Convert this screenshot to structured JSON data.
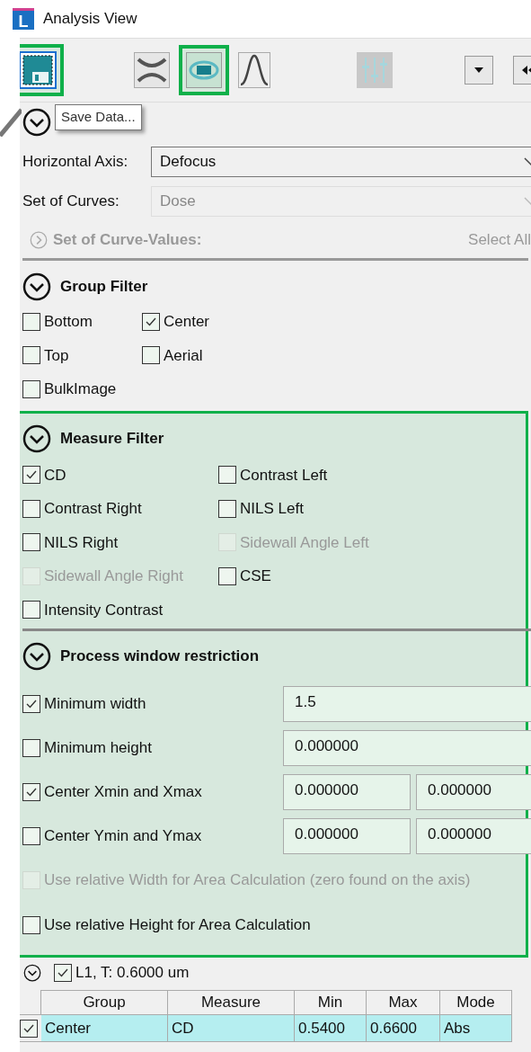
{
  "window": {
    "title": "Analysis View",
    "app_icon_letter": "L"
  },
  "toolbar": [
    {
      "kind": "save",
      "highlighted": true
    },
    {
      "kind": "curves",
      "highlighted": false
    },
    {
      "kind": "view",
      "highlighted": true
    },
    {
      "kind": "peak",
      "highlighted": false
    },
    {
      "kind": "sliders",
      "highlighted": false
    },
    {
      "kind": "dropdown",
      "highlighted": false
    },
    {
      "kind": "rewind",
      "highlighted": false
    }
  ],
  "tooltip": {
    "text": "Save Data..."
  },
  "axis_section": {
    "expanded": true,
    "fields": [
      {
        "label": "Horizontal Axis:",
        "value": "Defocus",
        "disabled": false
      },
      {
        "label": "Set of Curves:",
        "value": "Dose",
        "disabled": true
      }
    ],
    "curve_values": {
      "label": "Set of Curve-Values:",
      "expanded": false,
      "action": "Select All"
    }
  },
  "group_filter": {
    "title": "Group Filter",
    "expanded": true,
    "items": [
      {
        "label": "Bottom",
        "checked": false
      },
      {
        "label": "Center",
        "checked": true
      },
      {
        "label": "Top",
        "checked": false
      },
      {
        "label": "Aerial",
        "checked": false
      },
      {
        "label": "BulkImage",
        "checked": false
      }
    ]
  },
  "measure_filter": {
    "title": "Measure Filter",
    "expanded": true,
    "highlighted": true,
    "items": [
      {
        "label": "CD",
        "checked": true,
        "disabled": false
      },
      {
        "label": "Contrast Left",
        "checked": false,
        "disabled": false
      },
      {
        "label": "Contrast Right",
        "checked": false,
        "disabled": false
      },
      {
        "label": "NILS Left",
        "checked": false,
        "disabled": false
      },
      {
        "label": "NILS Right",
        "checked": false,
        "disabled": false
      },
      {
        "label": "Sidewall Angle Left",
        "checked": false,
        "disabled": true
      },
      {
        "label": "Sidewall Angle Right",
        "checked": false,
        "disabled": true
      },
      {
        "label": "CSE",
        "checked": false,
        "disabled": false
      },
      {
        "label": "Intensity Contrast",
        "checked": false,
        "disabled": false
      }
    ]
  },
  "process_window": {
    "title": "Process window restriction",
    "expanded": true,
    "highlighted": true,
    "rows": [
      {
        "label": "Minimum width",
        "checked": true,
        "disabled": false,
        "values": [
          "1.5"
        ]
      },
      {
        "label": "Minimum height",
        "checked": false,
        "disabled": false,
        "values": [
          "0.000000"
        ]
      },
      {
        "label": "Center Xmin and Xmax",
        "checked": true,
        "disabled": false,
        "values": [
          "0.000000",
          "0.000000"
        ]
      },
      {
        "label": "Center Ymin and Ymax",
        "checked": false,
        "disabled": false,
        "values": [
          "0.000000",
          "0.000000"
        ]
      },
      {
        "label": "Use relative Width for Area Calculation (zero found on the axis)",
        "checked": false,
        "disabled": true
      },
      {
        "label": "Use relative Height for Area Calculation",
        "checked": false,
        "disabled": false
      }
    ]
  },
  "tree_item": {
    "label": "L1, T: 0.6000 um",
    "expanded": true,
    "checked": true
  },
  "table": {
    "columns": [
      "Group",
      "Measure",
      "Min",
      "Max",
      "Mode"
    ],
    "rows": [
      {
        "checked": true,
        "selected": true,
        "cells": [
          "Center",
          "CD",
          "0.5400",
          "0.6600",
          "Abs"
        ]
      }
    ]
  }
}
